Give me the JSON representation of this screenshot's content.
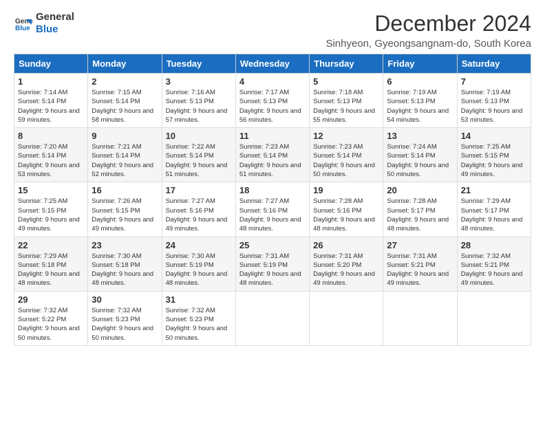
{
  "logo": {
    "line1": "General",
    "line2": "Blue"
  },
  "title": "December 2024",
  "subtitle": "Sinhyeon, Gyeongsangnam-do, South Korea",
  "days_of_week": [
    "Sunday",
    "Monday",
    "Tuesday",
    "Wednesday",
    "Thursday",
    "Friday",
    "Saturday"
  ],
  "weeks": [
    [
      {
        "day": "1",
        "sunrise": "7:14 AM",
        "sunset": "5:14 PM",
        "daylight": "9 hours and 59 minutes."
      },
      {
        "day": "2",
        "sunrise": "7:15 AM",
        "sunset": "5:14 PM",
        "daylight": "9 hours and 58 minutes."
      },
      {
        "day": "3",
        "sunrise": "7:16 AM",
        "sunset": "5:13 PM",
        "daylight": "9 hours and 57 minutes."
      },
      {
        "day": "4",
        "sunrise": "7:17 AM",
        "sunset": "5:13 PM",
        "daylight": "9 hours and 56 minutes."
      },
      {
        "day": "5",
        "sunrise": "7:18 AM",
        "sunset": "5:13 PM",
        "daylight": "9 hours and 55 minutes."
      },
      {
        "day": "6",
        "sunrise": "7:19 AM",
        "sunset": "5:13 PM",
        "daylight": "9 hours and 54 minutes."
      },
      {
        "day": "7",
        "sunrise": "7:19 AM",
        "sunset": "5:13 PM",
        "daylight": "9 hours and 53 minutes."
      }
    ],
    [
      {
        "day": "8",
        "sunrise": "7:20 AM",
        "sunset": "5:14 PM",
        "daylight": "9 hours and 53 minutes."
      },
      {
        "day": "9",
        "sunrise": "7:21 AM",
        "sunset": "5:14 PM",
        "daylight": "9 hours and 52 minutes."
      },
      {
        "day": "10",
        "sunrise": "7:22 AM",
        "sunset": "5:14 PM",
        "daylight": "9 hours and 51 minutes."
      },
      {
        "day": "11",
        "sunrise": "7:23 AM",
        "sunset": "5:14 PM",
        "daylight": "9 hours and 51 minutes."
      },
      {
        "day": "12",
        "sunrise": "7:23 AM",
        "sunset": "5:14 PM",
        "daylight": "9 hours and 50 minutes."
      },
      {
        "day": "13",
        "sunrise": "7:24 AM",
        "sunset": "5:14 PM",
        "daylight": "9 hours and 50 minutes."
      },
      {
        "day": "14",
        "sunrise": "7:25 AM",
        "sunset": "5:15 PM",
        "daylight": "9 hours and 49 minutes."
      }
    ],
    [
      {
        "day": "15",
        "sunrise": "7:25 AM",
        "sunset": "5:15 PM",
        "daylight": "9 hours and 49 minutes."
      },
      {
        "day": "16",
        "sunrise": "7:26 AM",
        "sunset": "5:15 PM",
        "daylight": "9 hours and 49 minutes."
      },
      {
        "day": "17",
        "sunrise": "7:27 AM",
        "sunset": "5:16 PM",
        "daylight": "9 hours and 49 minutes."
      },
      {
        "day": "18",
        "sunrise": "7:27 AM",
        "sunset": "5:16 PM",
        "daylight": "9 hours and 48 minutes."
      },
      {
        "day": "19",
        "sunrise": "7:28 AM",
        "sunset": "5:16 PM",
        "daylight": "9 hours and 48 minutes."
      },
      {
        "day": "20",
        "sunrise": "7:28 AM",
        "sunset": "5:17 PM",
        "daylight": "9 hours and 48 minutes."
      },
      {
        "day": "21",
        "sunrise": "7:29 AM",
        "sunset": "5:17 PM",
        "daylight": "9 hours and 48 minutes."
      }
    ],
    [
      {
        "day": "22",
        "sunrise": "7:29 AM",
        "sunset": "5:18 PM",
        "daylight": "9 hours and 48 minutes."
      },
      {
        "day": "23",
        "sunrise": "7:30 AM",
        "sunset": "5:18 PM",
        "daylight": "9 hours and 48 minutes."
      },
      {
        "day": "24",
        "sunrise": "7:30 AM",
        "sunset": "5:19 PM",
        "daylight": "9 hours and 48 minutes."
      },
      {
        "day": "25",
        "sunrise": "7:31 AM",
        "sunset": "5:19 PM",
        "daylight": "9 hours and 48 minutes."
      },
      {
        "day": "26",
        "sunrise": "7:31 AM",
        "sunset": "5:20 PM",
        "daylight": "9 hours and 49 minutes."
      },
      {
        "day": "27",
        "sunrise": "7:31 AM",
        "sunset": "5:21 PM",
        "daylight": "9 hours and 49 minutes."
      },
      {
        "day": "28",
        "sunrise": "7:32 AM",
        "sunset": "5:21 PM",
        "daylight": "9 hours and 49 minutes."
      }
    ],
    [
      {
        "day": "29",
        "sunrise": "7:32 AM",
        "sunset": "5:22 PM",
        "daylight": "9 hours and 50 minutes."
      },
      {
        "day": "30",
        "sunrise": "7:32 AM",
        "sunset": "5:23 PM",
        "daylight": "9 hours and 50 minutes."
      },
      {
        "day": "31",
        "sunrise": "7:32 AM",
        "sunset": "5:23 PM",
        "daylight": "9 hours and 50 minutes."
      },
      null,
      null,
      null,
      null
    ]
  ]
}
